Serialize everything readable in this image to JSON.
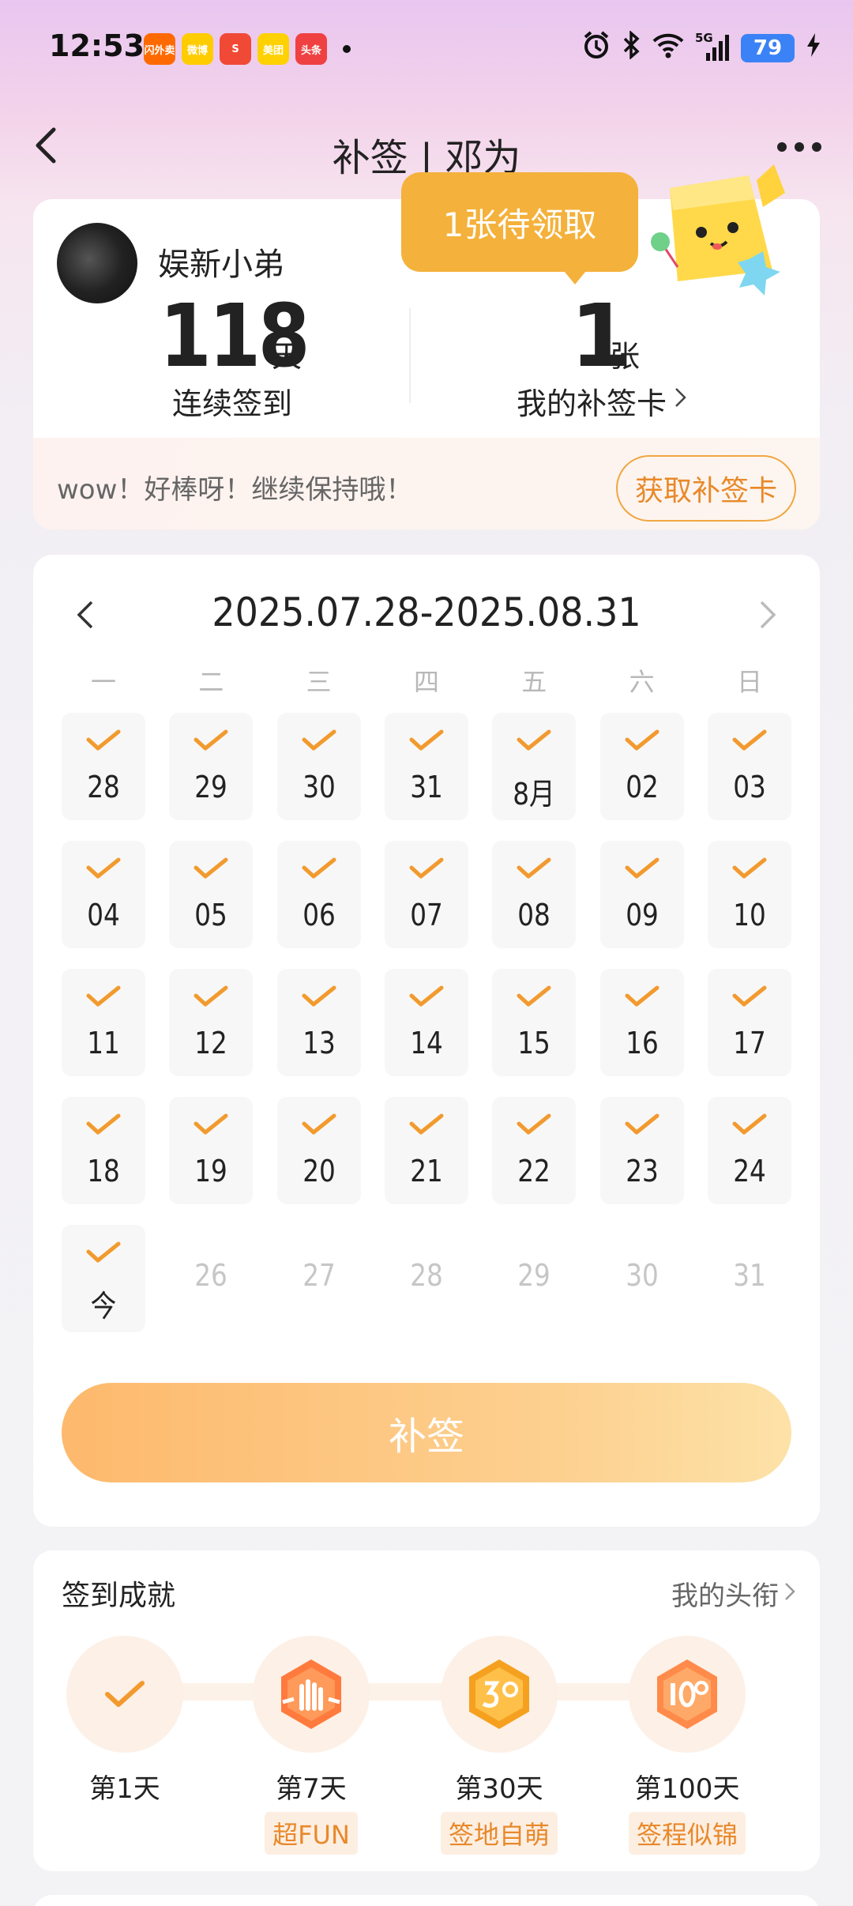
{
  "status_bar": {
    "time": "12:53",
    "apps": [
      {
        "name": "taobao-shangou",
        "label": "闪外卖",
        "color": "#ff6a00"
      },
      {
        "name": "weibo",
        "label": "微博",
        "color": "#ffcc00"
      },
      {
        "name": "sohu",
        "label": "S",
        "color": "#f04a36"
      },
      {
        "name": "meituan",
        "label": "美团",
        "color": "#ffd100"
      },
      {
        "name": "toutiao",
        "label": "头条",
        "color": "#f04142"
      }
    ],
    "network": "5G",
    "battery": "79"
  },
  "nav": {
    "title": "补签 | 邓为"
  },
  "profile": {
    "username": "娱新小弟",
    "streak_days": "118",
    "streak_unit": "天",
    "streak_label": "连续签到",
    "cards_count": "1",
    "cards_unit": "张",
    "cards_label": "我的补签卡",
    "pending_text": "1张待领取",
    "encourage": "wow！好棒呀！继续保持哦！",
    "get_card_label": "获取补签卡"
  },
  "calendar": {
    "range": "2025.07.28-2025.08.31",
    "weekdays": [
      "一",
      "二",
      "三",
      "四",
      "五",
      "六",
      "日"
    ],
    "rows": [
      [
        {
          "n": "28",
          "checked": true
        },
        {
          "n": "29",
          "checked": true
        },
        {
          "n": "30",
          "checked": true
        },
        {
          "n": "31",
          "checked": true
        },
        {
          "n": "8月",
          "checked": true
        },
        {
          "n": "02",
          "checked": true
        },
        {
          "n": "03",
          "checked": true
        }
      ],
      [
        {
          "n": "04",
          "checked": true
        },
        {
          "n": "05",
          "checked": true
        },
        {
          "n": "06",
          "checked": true
        },
        {
          "n": "07",
          "checked": true
        },
        {
          "n": "08",
          "checked": true
        },
        {
          "n": "09",
          "checked": true
        },
        {
          "n": "10",
          "checked": true
        }
      ],
      [
        {
          "n": "11",
          "checked": true
        },
        {
          "n": "12",
          "checked": true
        },
        {
          "n": "13",
          "checked": true
        },
        {
          "n": "14",
          "checked": true
        },
        {
          "n": "15",
          "checked": true
        },
        {
          "n": "16",
          "checked": true
        },
        {
          "n": "17",
          "checked": true
        }
      ],
      [
        {
          "n": "18",
          "checked": true
        },
        {
          "n": "19",
          "checked": true
        },
        {
          "n": "20",
          "checked": true
        },
        {
          "n": "21",
          "checked": true
        },
        {
          "n": "22",
          "checked": true
        },
        {
          "n": "23",
          "checked": true
        },
        {
          "n": "24",
          "checked": true
        }
      ],
      [
        {
          "n": "今",
          "checked": true
        },
        {
          "n": "26",
          "checked": false
        },
        {
          "n": "27",
          "checked": false
        },
        {
          "n": "28",
          "checked": false
        },
        {
          "n": "29",
          "checked": false
        },
        {
          "n": "30",
          "checked": false
        },
        {
          "n": "31",
          "checked": false
        }
      ]
    ],
    "button_label": "补签"
  },
  "achievements": {
    "title": "签到成就",
    "link_label": "我的头衔",
    "items": [
      {
        "label": "第1天",
        "tag": "",
        "icon": "check-icon"
      },
      {
        "label": "第7天",
        "tag": "超FUN",
        "icon": "rock-hand-badge-icon"
      },
      {
        "label": "第30天",
        "tag": "签地自萌",
        "icon": "30-days-badge-icon"
      },
      {
        "label": "第100天",
        "tag": "签程似锦",
        "icon": "100-days-badge-icon"
      }
    ]
  },
  "colors": {
    "accent": "#f0a640",
    "check": "#f29a2e",
    "button": "#fdc07a"
  }
}
